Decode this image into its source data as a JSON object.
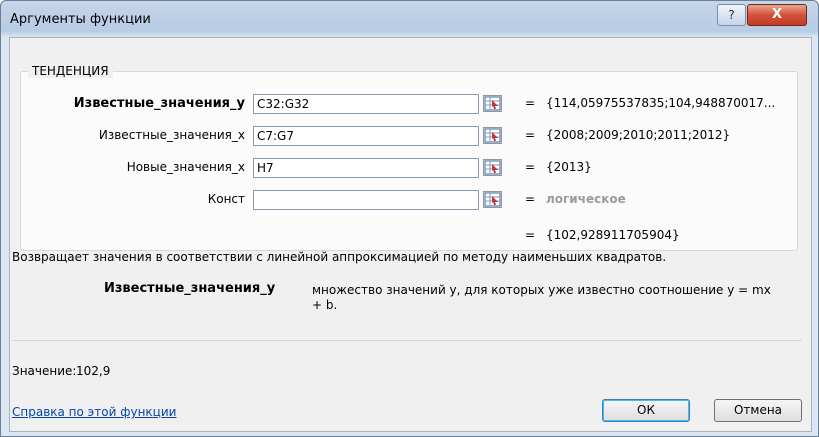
{
  "window": {
    "title": "Аргументы функции",
    "help_label": "?",
    "close_label": "X"
  },
  "function": {
    "name": "ТЕНДЕНЦИЯ"
  },
  "arguments": [
    {
      "label": "Известные_значения_y",
      "value": "C32:G32",
      "result": "{114,05975537835;104,948870017..."
    },
    {
      "label": "Известные_значения_x",
      "value": "C7:G7",
      "result": "{2008;2009;2010;2011;2012}"
    },
    {
      "label": "Новые_значения_x",
      "value": "H7",
      "result": "{2013}"
    },
    {
      "label": "Конст",
      "value": "",
      "result": "логическое"
    }
  ],
  "equals": "=",
  "formula_result": "{102,928911705904}",
  "description": "Возвращает значения в соответствии с линейной аппроксимацией по методу наименьших квадратов.",
  "arg_description": {
    "name": "Известные_значения_y",
    "text": "множество значений y, для которых уже известно соотношение y = mx + b."
  },
  "value_label": "Значение:",
  "value": "102,9",
  "help_link": "Справка по этой функции",
  "buttons": {
    "ok": "ОК",
    "cancel": "Отмена"
  },
  "icons": {
    "ref": "range-select-icon"
  }
}
